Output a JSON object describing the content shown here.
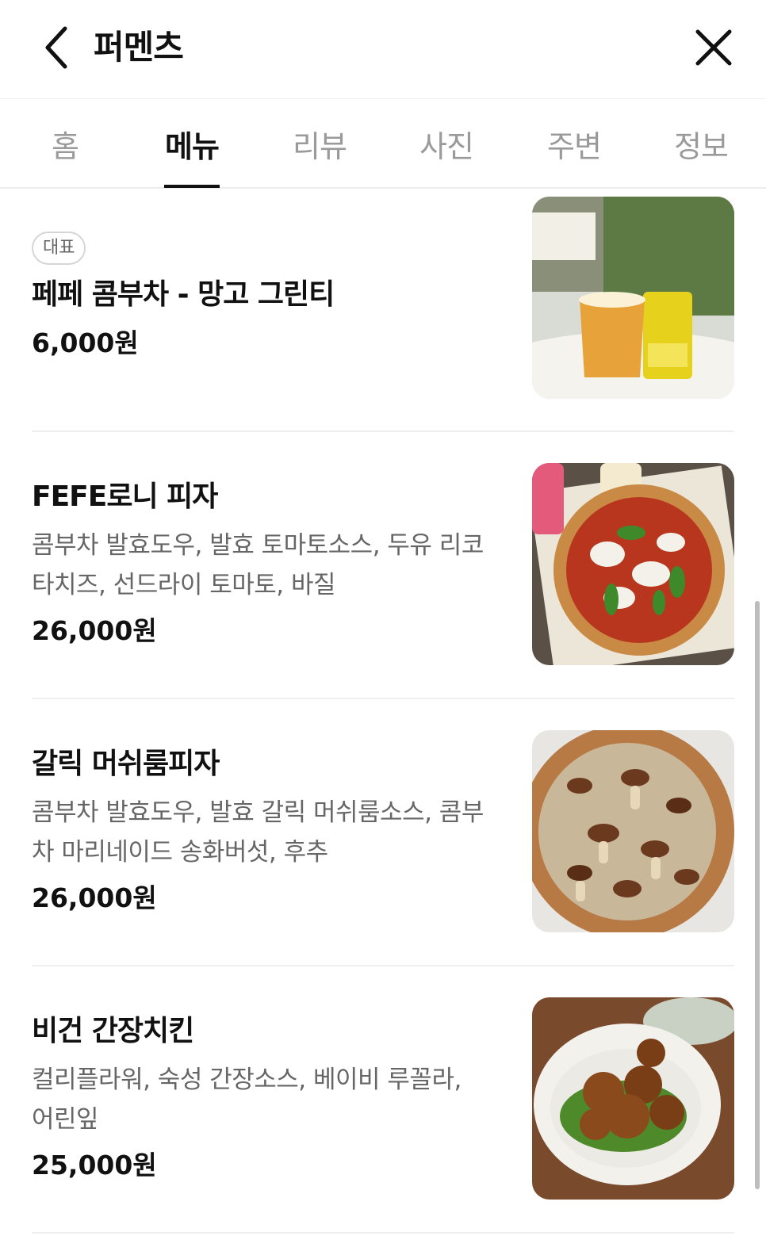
{
  "header": {
    "title": "퍼멘츠",
    "back_icon": "chevron-left-icon",
    "close_icon": "close-icon"
  },
  "tabs": [
    {
      "label": "홈",
      "active": false
    },
    {
      "label": "메뉴",
      "active": true
    },
    {
      "label": "리뷰",
      "active": false
    },
    {
      "label": "사진",
      "active": false
    },
    {
      "label": "주변",
      "active": false
    },
    {
      "label": "정보",
      "active": false
    }
  ],
  "menu": [
    {
      "badge": "대표",
      "name": "페페 콤부차 - 망고 그린티",
      "description": "",
      "price": "6,000원",
      "image": "kombucha-drink-photo"
    },
    {
      "name": "FEFE로니 피자",
      "description": "콤부차 발효도우, 발효 토마토소스, 두유 리코타치즈, 선드라이 토마토, 바질",
      "price": "26,000원",
      "image": "pizza-photo"
    },
    {
      "name": "갈릭 머쉬룸피자",
      "description": "콤부차 발효도우, 발효 갈릭 머쉬룸소스, 콤부차 마리네이드 송화버섯, 후추",
      "price": "26,000원",
      "image": "mushroom-pizza-photo"
    },
    {
      "name": "비건 간장치킨",
      "description": "컬리플라워, 숙성 간장소스, 베이비 루꼴라, 어린잎",
      "price": "25,000원",
      "image": "soy-chicken-photo"
    }
  ]
}
